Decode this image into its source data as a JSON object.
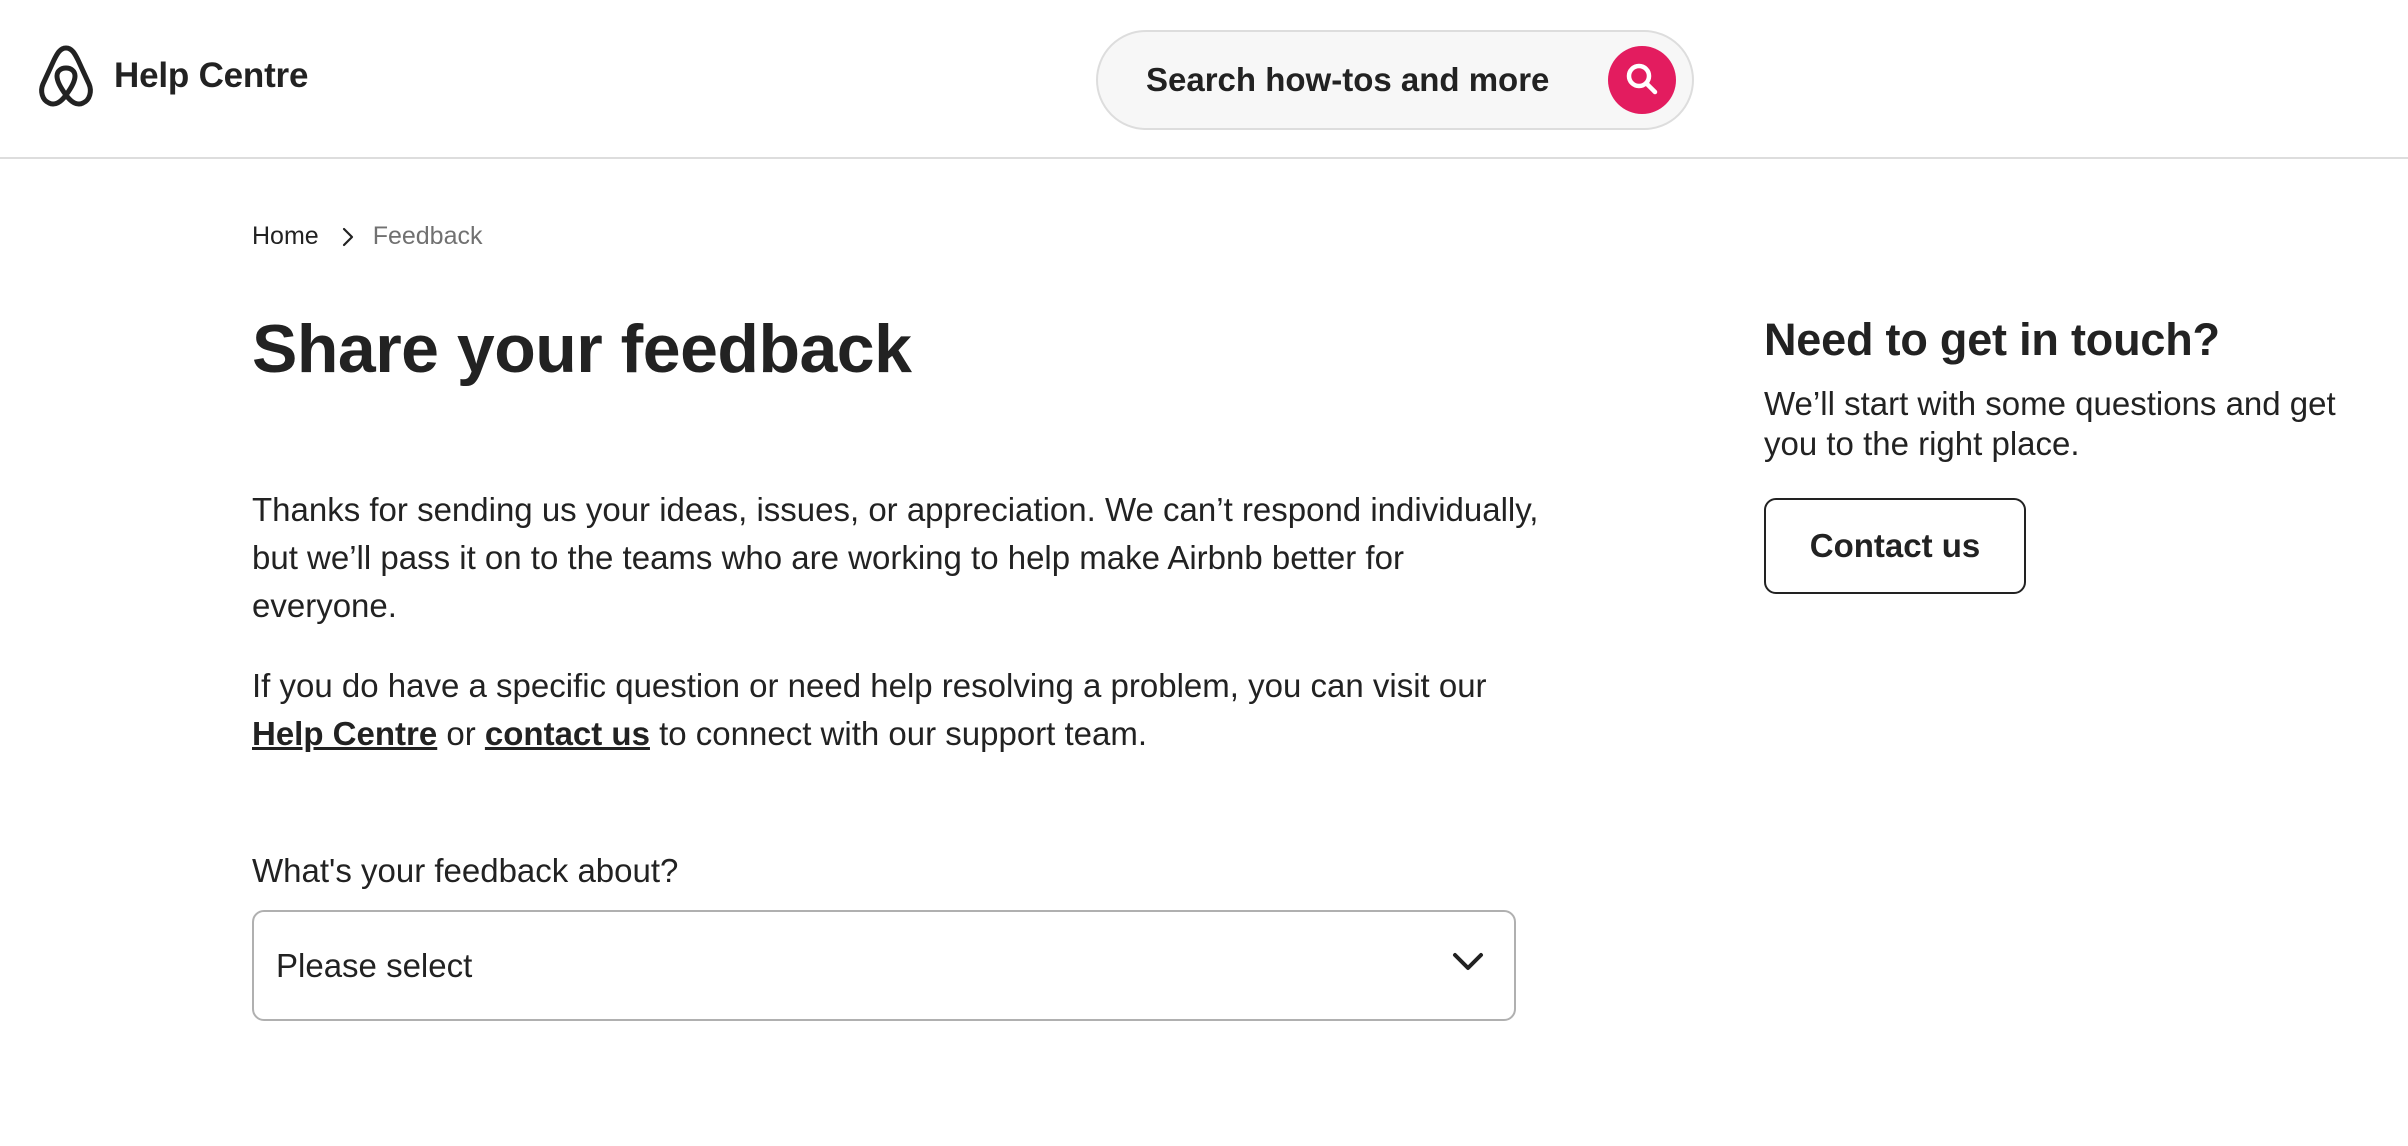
{
  "header": {
    "logo_text": "Help Centre",
    "search_placeholder": "Search how-tos and more"
  },
  "breadcrumb": {
    "home": "Home",
    "current": "Feedback"
  },
  "main": {
    "title": "Share your feedback",
    "paragraph_1": "Thanks for sending us your ideas, issues, or appreciation. We can’t respond individually, but we’ll pass it on to the teams who are working to help make Airbnb better for everyone.",
    "paragraph_2": {
      "before": "If you do have a specific question or need help resolving a problem, you can visit our ",
      "link_help": "Help Centre",
      "middle": " or ",
      "link_contact": "contact us",
      "after": " to connect with our support team."
    },
    "select_label": "What's your feedback about?",
    "select_value": "Please select"
  },
  "sidebar": {
    "title": "Need to get in touch?",
    "text": "We’ll start with some questions and get you to the right place.",
    "button_label": "Contact us"
  },
  "colors": {
    "brand": "#e31c5f",
    "text": "#222222",
    "muted": "#717171",
    "border": "#dddddd"
  }
}
